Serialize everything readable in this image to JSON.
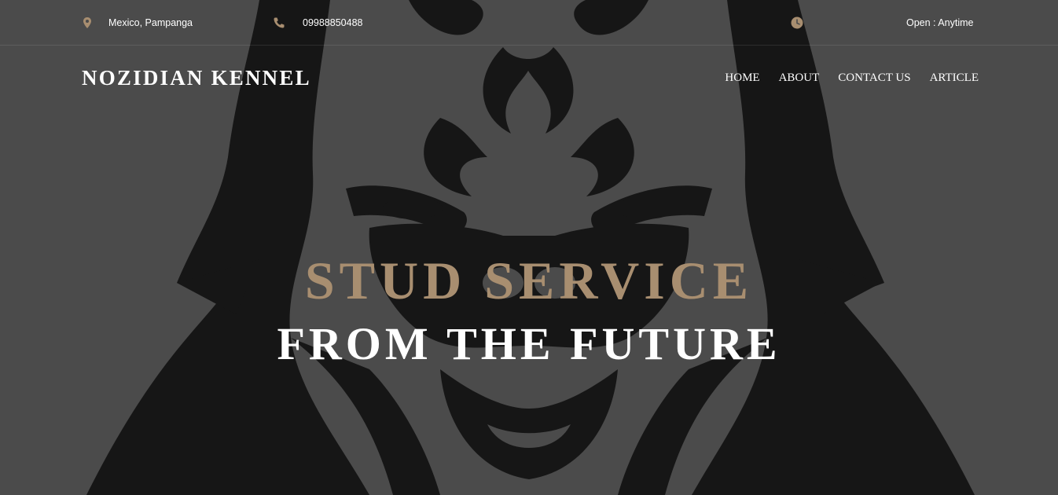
{
  "topbar": {
    "location": "Mexico, Pampanga",
    "phone": "09988850488",
    "hours": "Open : Anytime"
  },
  "header": {
    "brand": "NOZIDIAN KENNEL",
    "nav": [
      {
        "label": "HOME"
      },
      {
        "label": "ABOUT"
      },
      {
        "label": "CONTACT US"
      },
      {
        "label": "ARTICLE"
      }
    ]
  },
  "hero": {
    "title_line1": "STUD SERVICE",
    "title_line2": "FROM THE FUTURE"
  },
  "icons": {
    "location": "map-marker-icon",
    "phone": "phone-icon",
    "hours": "clock-icon"
  },
  "colors": {
    "accent": "#a88e70",
    "background": "#4a4a4a",
    "artwork": "#161616",
    "text": "#ffffff"
  }
}
